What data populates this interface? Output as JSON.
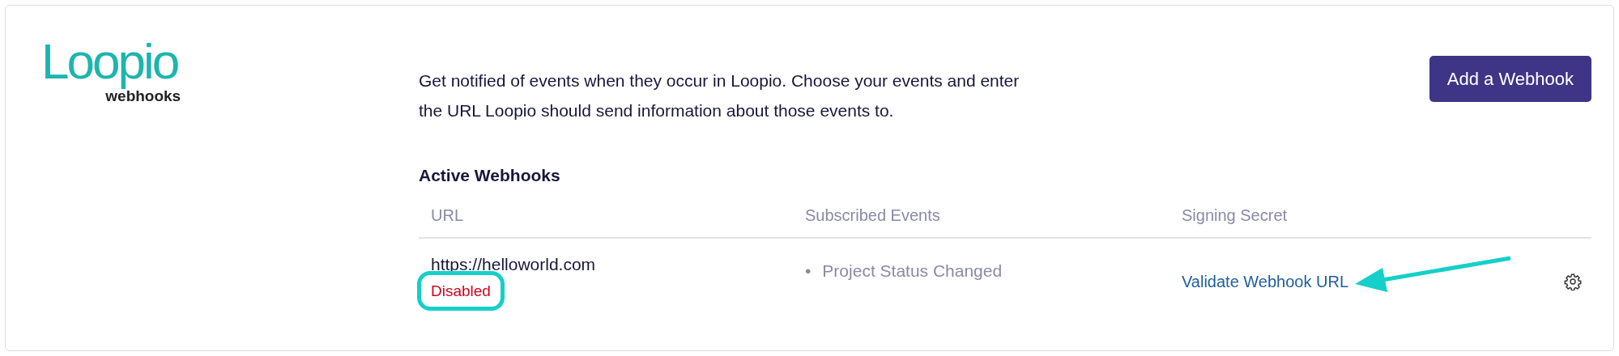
{
  "logo": {
    "brand": "Loopio",
    "product": "webhooks"
  },
  "description": "Get notified of events when they occur in Loopio. Choose your events and enter the URL Loopio should send information about those events to.",
  "add_button": "Add a Webhook",
  "section_title": "Active Webhooks",
  "table": {
    "columns": [
      "URL",
      "Subscribed Events",
      "Signing Secret"
    ],
    "rows": [
      {
        "url": "https://helloworld.com",
        "status": "Disabled",
        "disabled": true,
        "events": [
          {
            "marker": "•",
            "text": "Project Status Changed"
          }
        ],
        "signing_secret_action": "Validate Webhook URL"
      }
    ]
  },
  "annotations": {
    "status_ring": true,
    "link_arrow": true
  }
}
